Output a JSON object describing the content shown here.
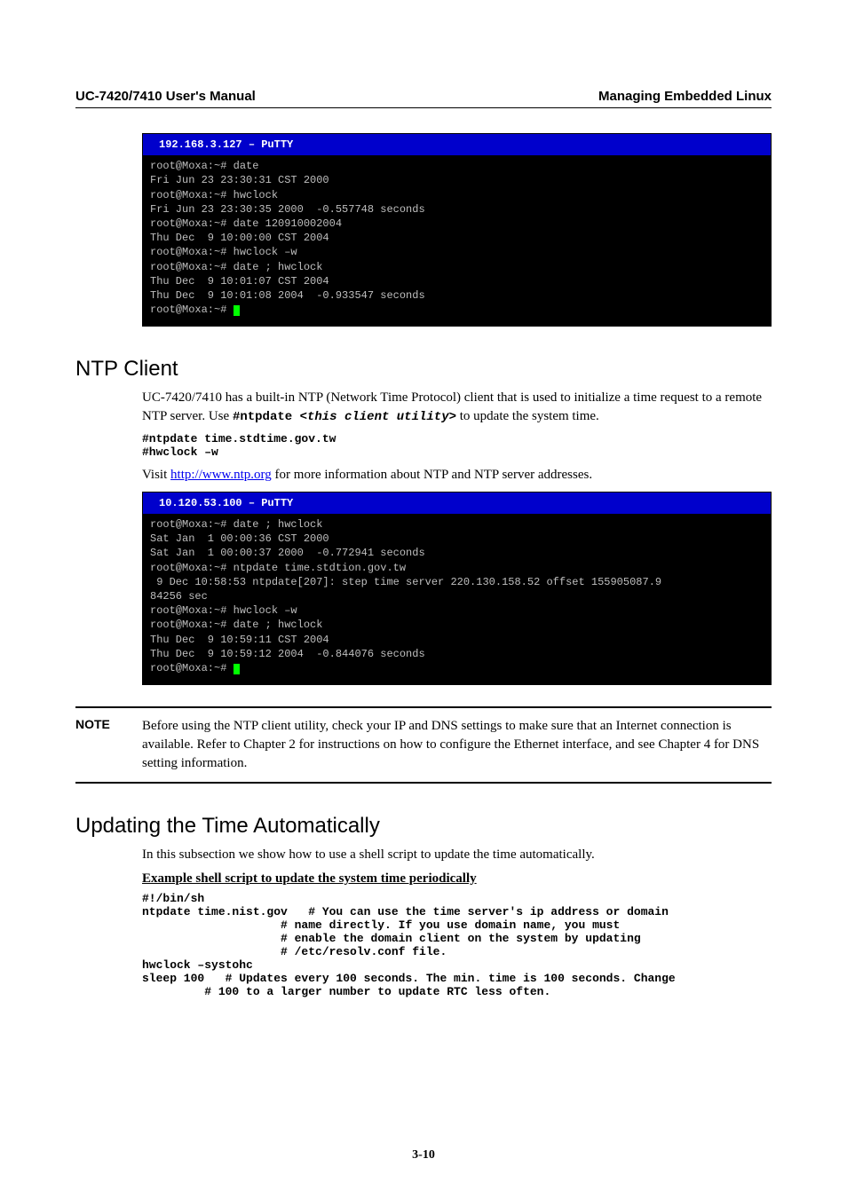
{
  "header": {
    "left": "UC-7420/7410 User's Manual",
    "right": "Managing Embedded Linux"
  },
  "terminals": {
    "t1": {
      "title": "  192.168.3.127 – PuTTY",
      "lines": [
        "root@Moxa:~# date",
        "Fri Jun 23 23:30:31 CST 2000",
        "root@Moxa:~# hwclock",
        "Fri Jun 23 23:30:35 2000  -0.557748 seconds",
        "root@Moxa:~# date 120910002004",
        "Thu Dec  9 10:00:00 CST 2004",
        "root@Moxa:~# hwclock –w",
        "root@Moxa:~# date ; hwclock",
        "Thu Dec  9 10:01:07 CST 2004",
        "Thu Dec  9 10:01:08 2004  -0.933547 seconds",
        "root@Moxa:~# "
      ]
    },
    "t2": {
      "title": "  10.120.53.100 – PuTTY",
      "lines": [
        "root@Moxa:~# date ; hwclock",
        "Sat Jan  1 00:00:36 CST 2000",
        "Sat Jan  1 00:00:37 2000  -0.772941 seconds",
        "root@Moxa:~# ntpdate time.stdtion.gov.tw",
        " 9 Dec 10:58:53 ntpdate[207]: step time server 220.130.158.52 offset 155905087.9",
        "84256 sec",
        "root@Moxa:~# hwclock –w",
        "root@Moxa:~# date ; hwclock",
        "Thu Dec  9 10:59:11 CST 2004",
        "Thu Dec  9 10:59:12 2004  -0.844076 seconds",
        "root@Moxa:~# "
      ]
    }
  },
  "sections": {
    "ntp_title": "NTP Client",
    "ntp_p1a": "UC-7420/7410 has a built-in NTP (Network Time Protocol) client that is used to initialize a time request to a remote NTP server. Use ",
    "ntp_cmd_prefix": "#ntpdate ",
    "ntp_cmd_arg": "<this client utility>",
    "ntp_p1b": " to update the system time.",
    "ntp_code": "#ntpdate time.stdtime.gov.tw\n#hwclock –w",
    "ntp_p2a": "Visit ",
    "ntp_link": "http://www.ntp.org",
    "ntp_p2b": " for more information about NTP and NTP server addresses.",
    "note_label": "NOTE",
    "note_body": "Before using the NTP client utility, check your IP and DNS settings to make sure that an Internet connection is available. Refer to Chapter 2 for instructions on how to configure the Ethernet interface, and see Chapter 4 for DNS setting information.",
    "upd_title": "Updating the Time Automatically",
    "upd_p1": "In this subsection we show how to use a shell script to update the time automatically.",
    "upd_sub": "Example shell script to update the system time periodically",
    "upd_code": "#!/bin/sh\nntpdate time.nist.gov   # You can use the time server's ip address or domain\n                    # name directly. If you use domain name, you must\n                    # enable the domain client on the system by updating\n                    # /etc/resolv.conf file.\nhwclock –systohc\nsleep 100   # Updates every 100 seconds. The min. time is 100 seconds. Change\n         # 100 to a larger number to update RTC less often."
  },
  "page_number": "3-10"
}
